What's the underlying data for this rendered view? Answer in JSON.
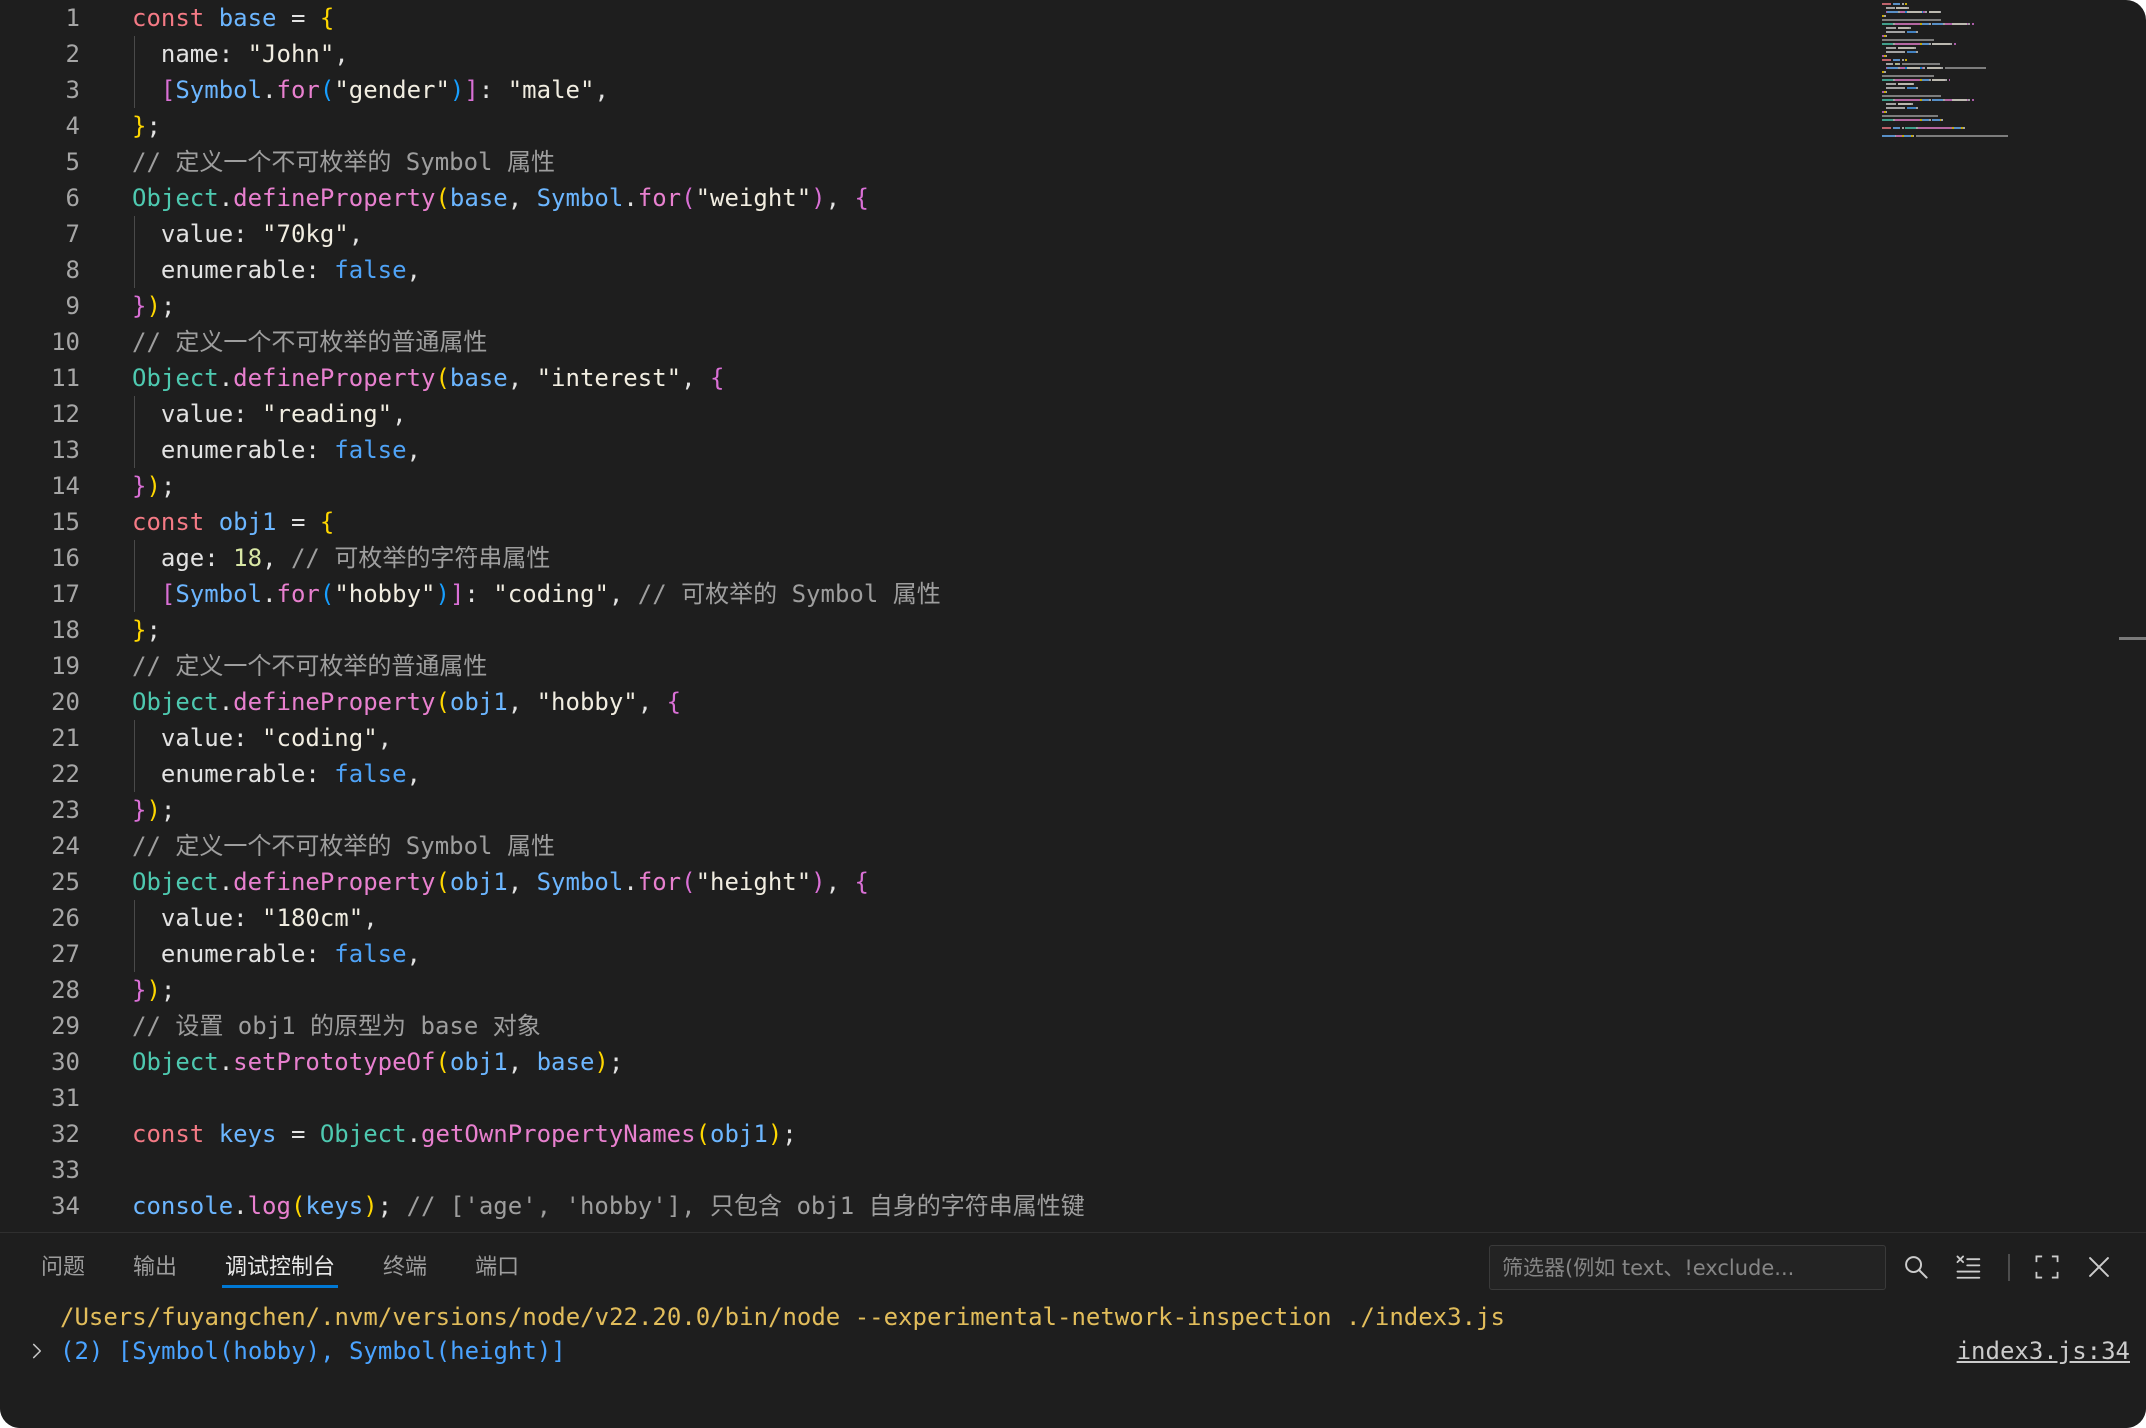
{
  "colors": {
    "accent": "#0078d4",
    "console_command": "#e2bd5b",
    "console_result": "#4aa3ff"
  },
  "editor": {
    "lines": [
      {
        "num": "1",
        "tokens": [
          {
            "text": "const",
            "color": "#f47a85"
          },
          {
            "text": " "
          },
          {
            "text": "base",
            "color": "#6cb6ff"
          },
          {
            "text": " = "
          },
          {
            "text": "{",
            "color": "#ffd700"
          }
        ]
      },
      {
        "num": "2",
        "tokens": [
          {
            "text": "  name: "
          },
          {
            "text": "\"John\"",
            "color": "#f1ede1"
          },
          {
            "text": ","
          }
        ]
      },
      {
        "num": "3",
        "tokens": [
          {
            "text": "  "
          },
          {
            "text": "[",
            "color": "#da70d6"
          },
          {
            "text": "Symbol",
            "color": "#6cb6ff"
          },
          {
            "text": "."
          },
          {
            "text": "for",
            "color": "#e880cf"
          },
          {
            "text": "(",
            "color": "#179fff"
          },
          {
            "text": "\"gender\"",
            "color": "#f1ede1"
          },
          {
            "text": ")",
            "color": "#179fff"
          },
          {
            "text": "]",
            "color": "#da70d6"
          },
          {
            "text": ": "
          },
          {
            "text": "\"male\"",
            "color": "#f1ede1"
          },
          {
            "text": ","
          }
        ]
      },
      {
        "num": "4",
        "tokens": [
          {
            "text": "}",
            "color": "#ffd700"
          },
          {
            "text": ";"
          }
        ]
      },
      {
        "num": "5",
        "tokens": [
          {
            "text": "// 定义一个不可枚举的 Symbol 属性",
            "color": "#9e9e9e"
          }
        ]
      },
      {
        "num": "6",
        "tokens": [
          {
            "text": "Object",
            "color": "#4ec9b0"
          },
          {
            "text": "."
          },
          {
            "text": "defineProperty",
            "color": "#e880cf"
          },
          {
            "text": "(",
            "color": "#ffd700"
          },
          {
            "text": "base",
            "color": "#6cb6ff"
          },
          {
            "text": ", "
          },
          {
            "text": "Symbol",
            "color": "#6cb6ff"
          },
          {
            "text": "."
          },
          {
            "text": "for",
            "color": "#e880cf"
          },
          {
            "text": "(",
            "color": "#da70d6"
          },
          {
            "text": "\"weight\"",
            "color": "#f1ede1"
          },
          {
            "text": ")",
            "color": "#da70d6"
          },
          {
            "text": ", "
          },
          {
            "text": "{",
            "color": "#da70d6"
          }
        ]
      },
      {
        "num": "7",
        "tokens": [
          {
            "text": "  value: "
          },
          {
            "text": "\"70kg\"",
            "color": "#f1ede1"
          },
          {
            "text": ","
          }
        ]
      },
      {
        "num": "8",
        "tokens": [
          {
            "text": "  enumerable: "
          },
          {
            "text": "false",
            "color": "#4fa3f7"
          },
          {
            "text": ","
          }
        ]
      },
      {
        "num": "9",
        "tokens": [
          {
            "text": "}",
            "color": "#da70d6"
          },
          {
            "text": ")",
            "color": "#ffd700"
          },
          {
            "text": ";"
          }
        ]
      },
      {
        "num": "10",
        "tokens": [
          {
            "text": "// 定义一个不可枚举的普通属性",
            "color": "#9e9e9e"
          }
        ]
      },
      {
        "num": "11",
        "tokens": [
          {
            "text": "Object",
            "color": "#4ec9b0"
          },
          {
            "text": "."
          },
          {
            "text": "defineProperty",
            "color": "#e880cf"
          },
          {
            "text": "(",
            "color": "#ffd700"
          },
          {
            "text": "base",
            "color": "#6cb6ff"
          },
          {
            "text": ", "
          },
          {
            "text": "\"interest\"",
            "color": "#f1ede1"
          },
          {
            "text": ", "
          },
          {
            "text": "{",
            "color": "#da70d6"
          }
        ]
      },
      {
        "num": "12",
        "tokens": [
          {
            "text": "  value: "
          },
          {
            "text": "\"reading\"",
            "color": "#f1ede1"
          },
          {
            "text": ","
          }
        ]
      },
      {
        "num": "13",
        "tokens": [
          {
            "text": "  enumerable: "
          },
          {
            "text": "false",
            "color": "#4fa3f7"
          },
          {
            "text": ","
          }
        ]
      },
      {
        "num": "14",
        "tokens": [
          {
            "text": "}",
            "color": "#da70d6"
          },
          {
            "text": ")",
            "color": "#ffd700"
          },
          {
            "text": ";"
          }
        ]
      },
      {
        "num": "15",
        "tokens": [
          {
            "text": "const",
            "color": "#f47a85"
          },
          {
            "text": " "
          },
          {
            "text": "obj1",
            "color": "#6cb6ff"
          },
          {
            "text": " = "
          },
          {
            "text": "{",
            "color": "#ffd700"
          }
        ]
      },
      {
        "num": "16",
        "tokens": [
          {
            "text": "  age: "
          },
          {
            "text": "18",
            "color": "#d9e7a5"
          },
          {
            "text": ", "
          },
          {
            "text": "// 可枚举的字符串属性",
            "color": "#9e9e9e"
          }
        ]
      },
      {
        "num": "17",
        "tokens": [
          {
            "text": "  "
          },
          {
            "text": "[",
            "color": "#da70d6"
          },
          {
            "text": "Symbol",
            "color": "#6cb6ff"
          },
          {
            "text": "."
          },
          {
            "text": "for",
            "color": "#e880cf"
          },
          {
            "text": "(",
            "color": "#179fff"
          },
          {
            "text": "\"hobby\"",
            "color": "#f1ede1"
          },
          {
            "text": ")",
            "color": "#179fff"
          },
          {
            "text": "]",
            "color": "#da70d6"
          },
          {
            "text": ": "
          },
          {
            "text": "\"coding\"",
            "color": "#f1ede1"
          },
          {
            "text": ", "
          },
          {
            "text": "// 可枚举的 Symbol 属性",
            "color": "#9e9e9e"
          }
        ]
      },
      {
        "num": "18",
        "tokens": [
          {
            "text": "}",
            "color": "#ffd700"
          },
          {
            "text": ";"
          }
        ]
      },
      {
        "num": "19",
        "tokens": [
          {
            "text": "// 定义一个不可枚举的普通属性",
            "color": "#9e9e9e"
          }
        ]
      },
      {
        "num": "20",
        "tokens": [
          {
            "text": "Object",
            "color": "#4ec9b0"
          },
          {
            "text": "."
          },
          {
            "text": "defineProperty",
            "color": "#e880cf"
          },
          {
            "text": "(",
            "color": "#ffd700"
          },
          {
            "text": "obj1",
            "color": "#6cb6ff"
          },
          {
            "text": ", "
          },
          {
            "text": "\"hobby\"",
            "color": "#f1ede1"
          },
          {
            "text": ", "
          },
          {
            "text": "{",
            "color": "#da70d6"
          }
        ]
      },
      {
        "num": "21",
        "tokens": [
          {
            "text": "  value: "
          },
          {
            "text": "\"coding\"",
            "color": "#f1ede1"
          },
          {
            "text": ","
          }
        ]
      },
      {
        "num": "22",
        "tokens": [
          {
            "text": "  enumerable: "
          },
          {
            "text": "false",
            "color": "#4fa3f7"
          },
          {
            "text": ","
          }
        ]
      },
      {
        "num": "23",
        "tokens": [
          {
            "text": "}",
            "color": "#da70d6"
          },
          {
            "text": ")",
            "color": "#ffd700"
          },
          {
            "text": ";"
          }
        ]
      },
      {
        "num": "24",
        "tokens": [
          {
            "text": "// 定义一个不可枚举的 Symbol 属性",
            "color": "#9e9e9e"
          }
        ]
      },
      {
        "num": "25",
        "tokens": [
          {
            "text": "Object",
            "color": "#4ec9b0"
          },
          {
            "text": "."
          },
          {
            "text": "defineProperty",
            "color": "#e880cf"
          },
          {
            "text": "(",
            "color": "#ffd700"
          },
          {
            "text": "obj1",
            "color": "#6cb6ff"
          },
          {
            "text": ", "
          },
          {
            "text": "Symbol",
            "color": "#6cb6ff"
          },
          {
            "text": "."
          },
          {
            "text": "for",
            "color": "#e880cf"
          },
          {
            "text": "(",
            "color": "#da70d6"
          },
          {
            "text": "\"height\"",
            "color": "#f1ede1"
          },
          {
            "text": ")",
            "color": "#da70d6"
          },
          {
            "text": ", "
          },
          {
            "text": "{",
            "color": "#da70d6"
          }
        ]
      },
      {
        "num": "26",
        "tokens": [
          {
            "text": "  value: "
          },
          {
            "text": "\"180cm\"",
            "color": "#f1ede1"
          },
          {
            "text": ","
          }
        ]
      },
      {
        "num": "27",
        "tokens": [
          {
            "text": "  enumerable: "
          },
          {
            "text": "false",
            "color": "#4fa3f7"
          },
          {
            "text": ","
          }
        ]
      },
      {
        "num": "28",
        "tokens": [
          {
            "text": "}",
            "color": "#da70d6"
          },
          {
            "text": ")",
            "color": "#ffd700"
          },
          {
            "text": ";"
          }
        ]
      },
      {
        "num": "29",
        "tokens": [
          {
            "text": "// 设置 obj1 的原型为 base 对象",
            "color": "#9e9e9e"
          }
        ]
      },
      {
        "num": "30",
        "tokens": [
          {
            "text": "Object",
            "color": "#4ec9b0"
          },
          {
            "text": "."
          },
          {
            "text": "setPrototypeOf",
            "color": "#e880cf"
          },
          {
            "text": "(",
            "color": "#ffd700"
          },
          {
            "text": "obj1",
            "color": "#6cb6ff"
          },
          {
            "text": ", "
          },
          {
            "text": "base",
            "color": "#6cb6ff"
          },
          {
            "text": ")",
            "color": "#ffd700"
          },
          {
            "text": ";"
          }
        ]
      },
      {
        "num": "31",
        "tokens": []
      },
      {
        "num": "32",
        "tokens": [
          {
            "text": "const",
            "color": "#f47a85"
          },
          {
            "text": " "
          },
          {
            "text": "keys",
            "color": "#6cb6ff"
          },
          {
            "text": " = "
          },
          {
            "text": "Object",
            "color": "#4ec9b0"
          },
          {
            "text": "."
          },
          {
            "text": "getOwnPropertyNames",
            "color": "#e880cf"
          },
          {
            "text": "(",
            "color": "#ffd700"
          },
          {
            "text": "obj1",
            "color": "#6cb6ff"
          },
          {
            "text": ")",
            "color": "#ffd700"
          },
          {
            "text": ";"
          }
        ]
      },
      {
        "num": "33",
        "tokens": []
      },
      {
        "num": "34",
        "tokens": [
          {
            "text": "console",
            "color": "#6cb6ff"
          },
          {
            "text": "."
          },
          {
            "text": "log",
            "color": "#e880cf"
          },
          {
            "text": "(",
            "color": "#ffd700"
          },
          {
            "text": "keys",
            "color": "#6cb6ff"
          },
          {
            "text": ")",
            "color": "#ffd700"
          },
          {
            "text": "; "
          },
          {
            "text": "// ['age', 'hobby'], 只包含 obj1 自身的字符串属性键",
            "color": "#9e9e9e"
          }
        ]
      }
    ]
  },
  "panel": {
    "tabs": [
      {
        "label": "问题",
        "active": false
      },
      {
        "label": "输出",
        "active": false
      },
      {
        "label": "调试控制台",
        "active": true
      },
      {
        "label": "终端",
        "active": false
      },
      {
        "label": "端口",
        "active": false
      }
    ],
    "filter": {
      "placeholder": "筛选器(例如 text、!exclude..."
    },
    "toolbar_icons": [
      "search-icon",
      "clear-console-icon",
      "maximize-panel-icon",
      "close-panel-icon"
    ],
    "console": {
      "command": "/Users/fuyangchen/.nvm/versions/node/v22.20.0/bin/node --experimental-network-inspection ./index3.js",
      "result": "(2) [Symbol(hobby), Symbol(height)]",
      "source": "index3.js:34"
    }
  }
}
